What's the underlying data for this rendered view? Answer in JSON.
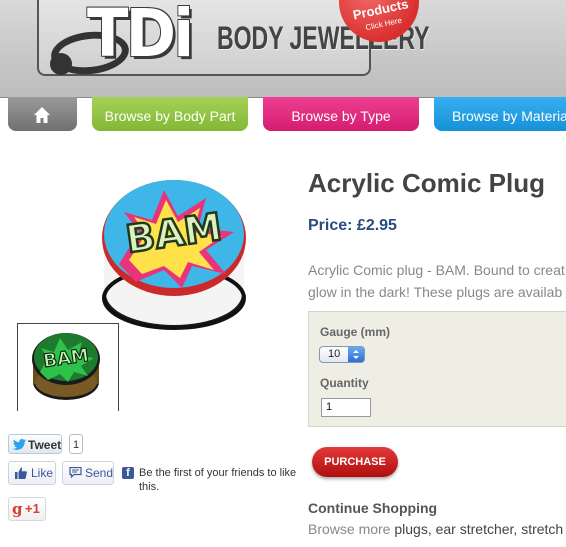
{
  "header": {
    "logo_text": "TDi",
    "logo_subtitle": "BODY JEWELLERY",
    "badge_title": "Products",
    "badge_sub": "Click Here"
  },
  "nav": {
    "home_icon": "home-icon",
    "tabs": [
      {
        "label": "Browse by Body Part",
        "color": "#94c447"
      },
      {
        "label": "Browse by Type",
        "color": "#e02d82"
      },
      {
        "label": "Browse by Materia",
        "color": "#26a0e6"
      }
    ]
  },
  "product": {
    "image_word": "BAM",
    "title": "Acrylic Comic Plug",
    "price": "Price: £2.95",
    "description_lines": [
      "Acrylic Comic plug - BAM. Bound to creat",
      "glow in the dark! These plugs are availab"
    ],
    "options": {
      "gauge_label": "Gauge (mm)",
      "gauge_value": "10",
      "quantity_label": "Quantity",
      "quantity_value": "1"
    },
    "purchase_label": "PURCHASE"
  },
  "social": {
    "tweet_label": "Tweet",
    "tweet_count": "1",
    "like_label": "Like",
    "send_label": "Send",
    "fb_text": "Be the first of your friends to like this.",
    "gplus_label": "+1"
  },
  "continue": {
    "heading": "Continue Shopping",
    "prefix": "Browse more ",
    "links": "plugs, ear stretcher, stretch"
  }
}
